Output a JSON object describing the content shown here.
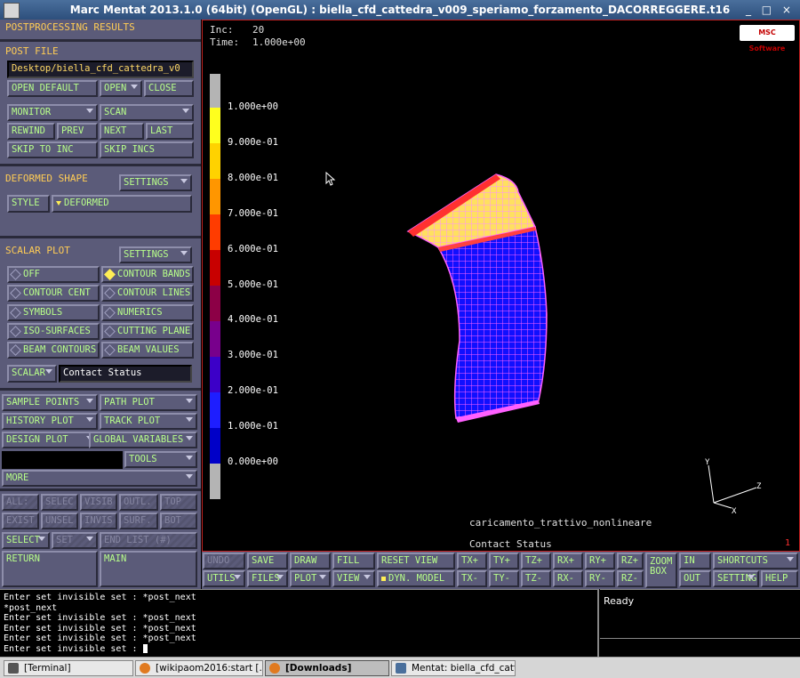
{
  "window": {
    "title": "Marc Mentat 2013.1.0 (64bit) (OpenGL) : biella_cfd_cattedra_v009_speriamo_forzamento_DACORREGGERE.t16",
    "controls": "_ □ ×"
  },
  "left": {
    "post_results_header": "POSTPROCESSING RESULTS",
    "post_file_header": "POST FILE",
    "post_file_value": "Desktop/biella_cfd_cattedra_v0",
    "buttons": {
      "open_default": "OPEN DEFAULT",
      "open": "OPEN",
      "close": "CLOSE",
      "monitor": "MONITOR",
      "scan": "SCAN",
      "rewind": "REWIND",
      "prev": "PREV",
      "next": "NEXT",
      "last": "LAST",
      "skip_to_inc": "SKIP TO INC",
      "skip_incs": "SKIP INCS"
    },
    "deformed_header": "DEFORMED SHAPE",
    "deformed_settings": "SETTINGS",
    "style_label": "STYLE",
    "style_value": "DEFORMED",
    "scalar_header": "SCALAR PLOT",
    "scalar_settings": "SETTINGS",
    "scalar_options": {
      "off": "OFF",
      "contour_bands": "CONTOUR BANDS",
      "contour_cent": "CONTOUR CENT",
      "contour_lines": "CONTOUR LINES",
      "symbols": "SYMBOLS",
      "numerics": "NUMERICS",
      "iso_surfaces": "ISO-SURFACES",
      "cutting_plane": "CUTTING PLANE",
      "beam_contours": "BEAM CONTOURS",
      "beam_values": "BEAM VALUES"
    },
    "scalar_button": "SCALAR",
    "scalar_value": "Contact Status",
    "sample_points": "SAMPLE POINTS",
    "path_plot": "PATH PLOT",
    "history_plot": "HISTORY PLOT",
    "track_plot": "TRACK PLOT",
    "design_plot": "DESIGN PLOT",
    "global_variables": "GLOBAL VARIABLES",
    "tools": "TOOLS",
    "more": "MORE",
    "set_row1": [
      "ALL:",
      "SELEC",
      "VISIB",
      "OUTL.",
      "TOP"
    ],
    "set_row2": [
      "EXIST",
      "UNSEL",
      "INVIS",
      "SURF.",
      "BOT"
    ],
    "select": "SELECT",
    "set": "SET",
    "end_list": "END LIST (#)",
    "return": "RETURN",
    "main": "MAIN"
  },
  "viewport": {
    "inc_label": "Inc:",
    "inc_value": "20",
    "time_label": "Time:",
    "time_value": "1.000e+00",
    "logo": "MSC Software",
    "legend": [
      "1.000e+00",
      "9.000e-01",
      "8.000e-01",
      "7.000e-01",
      "6.000e-01",
      "5.000e-01",
      "4.000e-01",
      "3.000e-01",
      "2.000e-01",
      "1.000e-01",
      "0.000e+00"
    ],
    "legend_colors": [
      "#b4b4b4",
      "#ffff1e",
      "#ffd200",
      "#ff9600",
      "#ff3c00",
      "#c80000",
      "#8c0046",
      "#78008c",
      "#3c00c8",
      "#1e1eff",
      "#0000c8",
      "#b4b4b4"
    ],
    "loadcase": "caricamento_trattivo_nonlineare",
    "scalar_name": "Contact Status",
    "corner_index": "1",
    "axes": {
      "x": "X",
      "y": "Y",
      "z": "Z"
    }
  },
  "toolbar": {
    "undo": "UNDO",
    "save": "SAVE",
    "draw": "DRAW",
    "fill": "FILL",
    "reset_view": "RESET VIEW",
    "tx_plus": "TX+",
    "ty_plus": "TY+",
    "tz_plus": "TZ+",
    "rx_plus": "RX+",
    "ry_plus": "RY+",
    "rz_plus": "RZ+",
    "zoom_box": "ZOOM BOX",
    "in": "IN",
    "shortcuts": "SHORTCUTS",
    "utils": "UTILS",
    "files": "FILES",
    "plot": "PLOT",
    "view": "VIEW",
    "dyn_model": "DYN. MODEL",
    "tx_minus": "TX-",
    "ty_minus": "TY-",
    "tz_minus": "TZ-",
    "rx_minus": "RX-",
    "ry_minus": "RY-",
    "rz_minus": "RZ-",
    "out": "OUT",
    "settings": "SETTINGS",
    "help": "HELP"
  },
  "console": {
    "lines": [
      "Enter set invisible set : *post_next",
      "*post_next",
      "Enter set invisible set : *post_next",
      "Enter set invisible set : *post_next",
      "Enter set invisible set : *post_next"
    ],
    "prompt": "Enter set invisible set : "
  },
  "status": {
    "text": "Ready"
  },
  "taskbar": {
    "items": [
      "[Terminal]",
      "[wikipaom2016:start [...",
      "[Downloads]",
      "Mentat: biella_cfd_catt..."
    ]
  }
}
